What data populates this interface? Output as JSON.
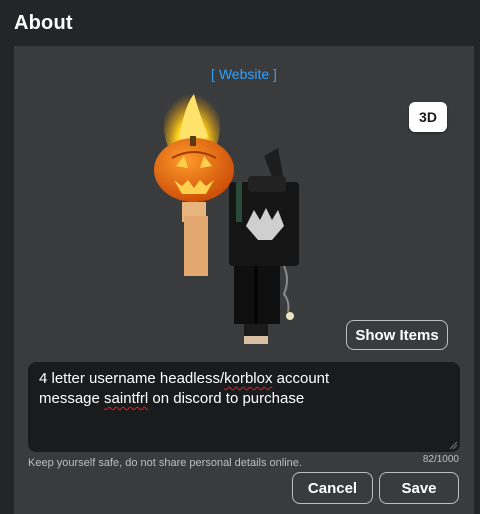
{
  "header": {
    "title": "About"
  },
  "panel": {
    "website_link": "[ Website ]",
    "view_toggle_label": "3D",
    "show_items_label": "Show Items"
  },
  "description": {
    "line1_pre": "4 letter username headless/",
    "line1_flag": "korblox",
    "line1_post": " account",
    "line2_pre": "message ",
    "line2_flag": "saintfrl",
    "line2_post": " on discord to purchase"
  },
  "help_text": "Keep yourself safe, do not share personal details online.",
  "char_counter": "82/1000",
  "actions": {
    "cancel_label": "Cancel",
    "save_label": "Save"
  },
  "colors": {
    "page_bg": "#232527",
    "panel_bg": "#393b3d",
    "input_bg": "#191b1d",
    "link": "#2ea1ff",
    "spell_underline": "#e02020"
  }
}
